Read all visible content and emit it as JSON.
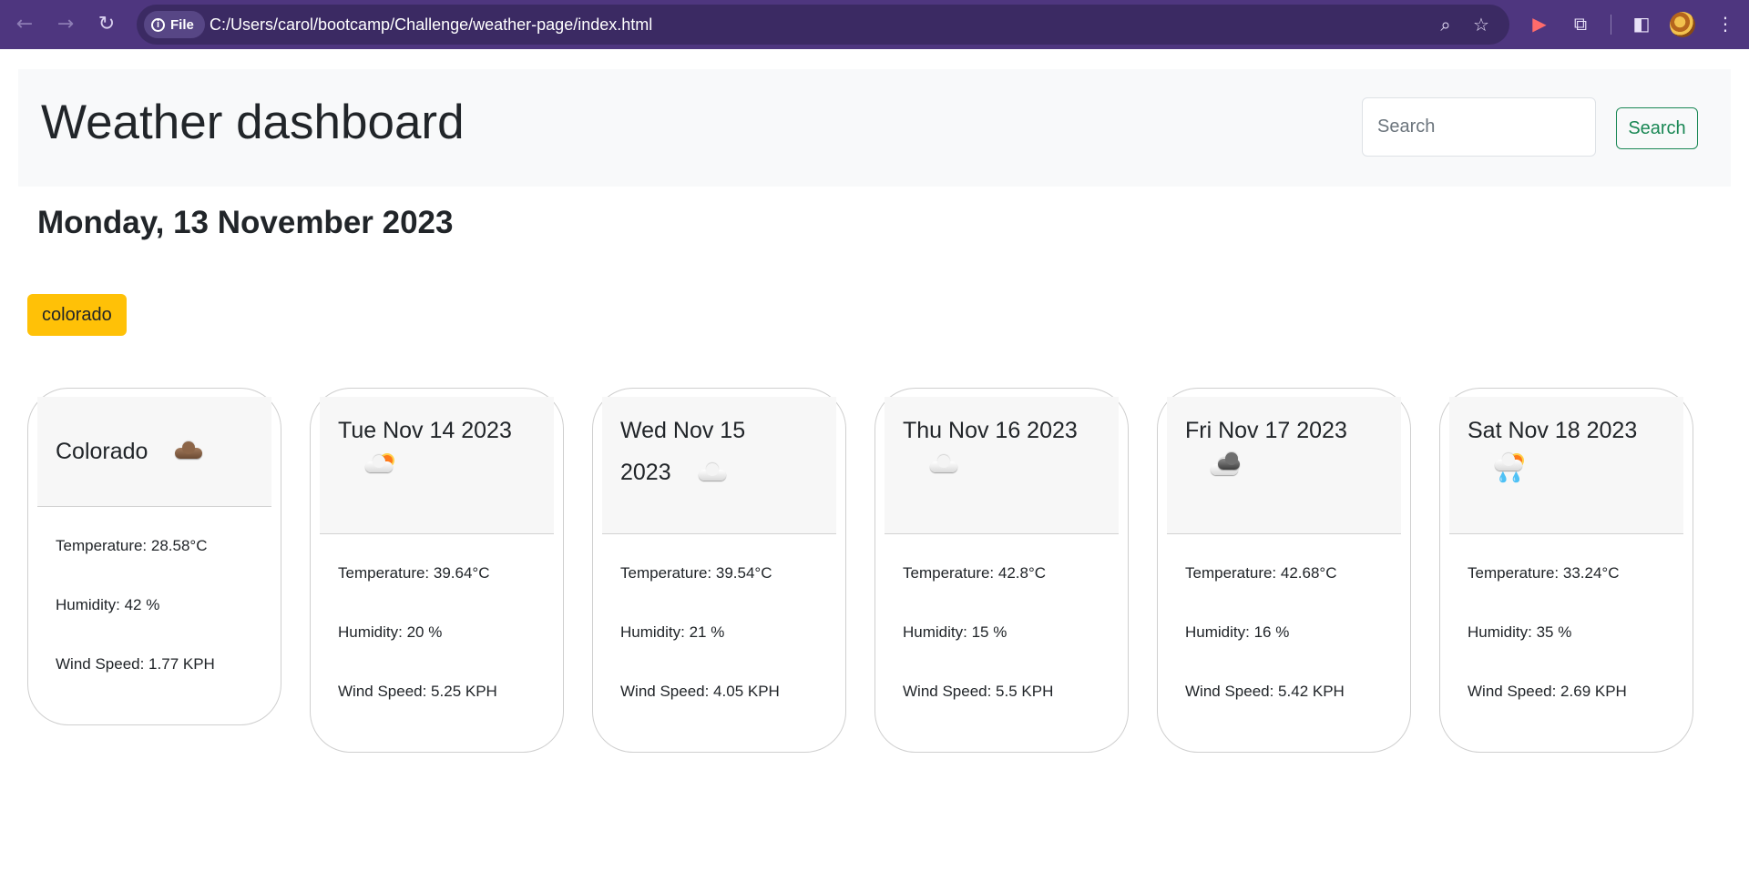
{
  "browser": {
    "file_chip": "File",
    "url": "C:/Users/carol/bootcamp/Challenge/weather-page/index.html"
  },
  "header": {
    "brand": "Weather dashboard",
    "search_placeholder": "Search",
    "search_button": "Search"
  },
  "date_heading": "Monday, 13 November 2023",
  "history": [
    "colorado"
  ],
  "current": {
    "title": "Colorado",
    "icon": "cloud-brown-icon",
    "temperature": "Temperature: 28.58°C",
    "humidity": "Humidity: 42 %",
    "wind": "Wind Speed: 1.77 KPH"
  },
  "forecast": [
    {
      "title": "Tue Nov 14 2023",
      "icon": "sun-behind-cloud-icon",
      "temperature": "Temperature: 39.64°C",
      "humidity": "Humidity: 20 %",
      "wind": "Wind Speed: 5.25 KPH"
    },
    {
      "title": "Wed Nov 15 2023",
      "icon": "cloud-icon",
      "temperature": "Temperature: 39.54°C",
      "humidity": "Humidity: 21 %",
      "wind": "Wind Speed: 4.05 KPH"
    },
    {
      "title": "Thu Nov 16 2023",
      "icon": "cloud-icon",
      "temperature": "Temperature: 42.8°C",
      "humidity": "Humidity: 15 %",
      "wind": "Wind Speed: 5.5 KPH"
    },
    {
      "title": "Fri Nov 17 2023",
      "icon": "dark-clouds-icon",
      "temperature": "Temperature: 42.68°C",
      "humidity": "Humidity: 16 %",
      "wind": "Wind Speed: 5.42 KPH"
    },
    {
      "title": "Sat Nov 18 2023",
      "icon": "sun-rain-icon",
      "temperature": "Temperature: 33.24°C",
      "humidity": "Humidity: 35 %",
      "wind": "Wind Speed: 2.69 KPH"
    }
  ],
  "colors": {
    "chrome": "#4e367f",
    "search_button": "#198754",
    "history_button": "#ffc107"
  }
}
